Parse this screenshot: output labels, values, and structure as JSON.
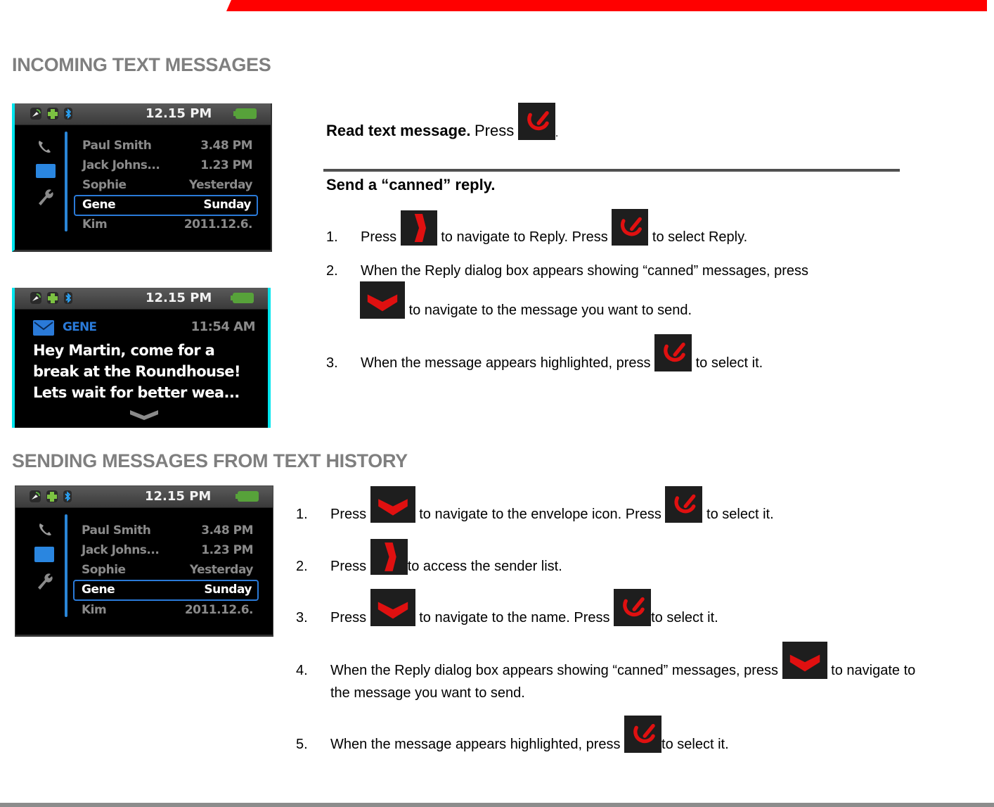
{
  "sections": {
    "incoming": {
      "title": "INCOMING TEXT MESSAGES",
      "read": {
        "bold": "Read text message.",
        "text": "Press",
        "after": "."
      },
      "canned": {
        "title": "Send a “canned” reply.",
        "steps": [
          {
            "num": "1.",
            "parts": [
              "Press",
              "to navigate to Reply. Press",
              "to select Reply."
            ],
            "keys": [
              "right-arrow-key",
              "select-key"
            ]
          },
          {
            "num": "2.",
            "parts": [
              "When the Reply dialog box appears showing “canned” messages, press",
              "to navigate to the message you want to send."
            ],
            "keys": [
              "down-arrow-key"
            ]
          },
          {
            "num": "3.",
            "parts": [
              "When the message appears highlighted, press",
              "to select it."
            ],
            "keys": [
              "select-key"
            ]
          }
        ]
      }
    },
    "history": {
      "title": "SENDING MESSAGES FROM TEXT HISTORY",
      "steps": [
        {
          "num": "1.",
          "parts": [
            "Press",
            "to navigate to the envelope icon. Press",
            "to select it."
          ],
          "keys": [
            "down-arrow-key",
            "select-key"
          ]
        },
        {
          "num": "2.",
          "parts": [
            "Press",
            "to access the sender list."
          ],
          "keys": [
            "right-arrow-key"
          ]
        },
        {
          "num": "3.",
          "parts": [
            "Press",
            "to navigate to the name. Press",
            "to select it."
          ],
          "keys": [
            "down-arrow-key",
            "select-key"
          ]
        },
        {
          "num": "4.",
          "parts": [
            "When the Reply dialog box appears showing “canned” messages, press",
            "to navigate to",
            "the message you want to send."
          ],
          "keys": [
            "down-arrow-key"
          ]
        },
        {
          "num": "5.",
          "parts": [
            "When the message appears highlighted, press",
            "to select it."
          ],
          "keys": [
            "select-key"
          ]
        }
      ]
    }
  },
  "device": {
    "status_time": "12.15 PM",
    "status_icons": [
      "gps-icon",
      "plus-icon",
      "bluetooth-icon",
      "battery-icon"
    ],
    "contacts": [
      {
        "name": "Paul Smith",
        "when": "3.48 PM"
      },
      {
        "name": "Jack Johns...",
        "when": "1.23 PM"
      },
      {
        "name": "Sophie",
        "when": "Yesterday"
      },
      {
        "name": "Gene",
        "when": "Sunday",
        "selected": true
      },
      {
        "name": "Kim",
        "when": "2011.12.6."
      }
    ],
    "message": {
      "sender": "GENE",
      "time": "11:54 AM",
      "lines": [
        "Hey Martin, come for a",
        "break at the Roundhouse!",
        "Lets wait for better wea..."
      ]
    }
  },
  "colors": {
    "accent_red": "#ff0000",
    "heading_gray": "#7f7f7f",
    "device_blue": "#2a86d8",
    "battery_green": "#57a23a"
  }
}
